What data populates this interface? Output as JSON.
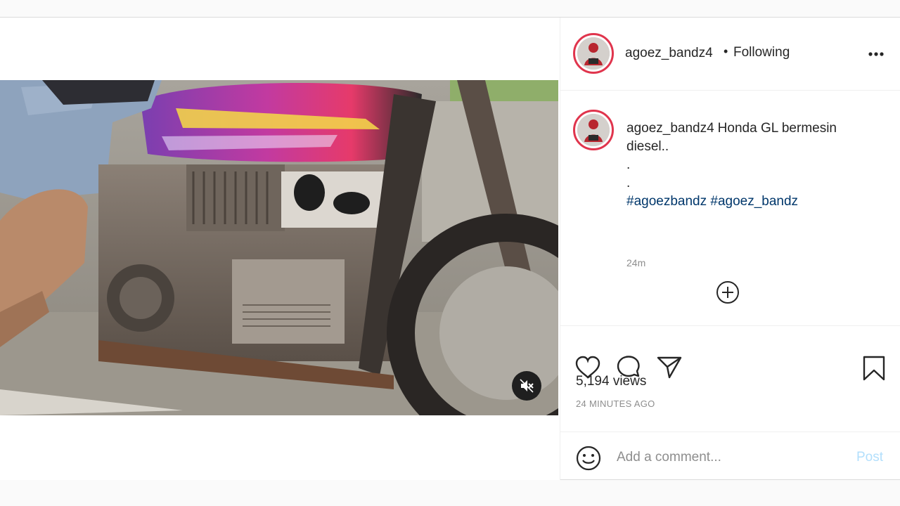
{
  "post": {
    "username": "agoez_bandz4",
    "separator": "•",
    "follow_status": "Following",
    "more_icon": "more-horizontal-icon",
    "caption": {
      "username": "agoez_bandz4",
      "text": "Honda GL bermesin diesel..",
      "dots": [
        ".",
        "."
      ],
      "hashtags": [
        "#agoezbandz",
        "#agoez_bandz"
      ],
      "time": "24m"
    },
    "load_more_icon": "plus-circle-icon",
    "views": "5,194 views",
    "timestamp": "24 MINUTES AGO",
    "comment": {
      "placeholder": "Add a comment...",
      "post_label": "Post"
    },
    "video": {
      "sound": "muted",
      "mute_icon": "speaker-muted-icon"
    }
  },
  "colors": {
    "link": "#00376b",
    "post_button_disabled": "#b2dffc",
    "avatar_ring": "#e0354d",
    "secondary_text": "#8e8e8e"
  }
}
